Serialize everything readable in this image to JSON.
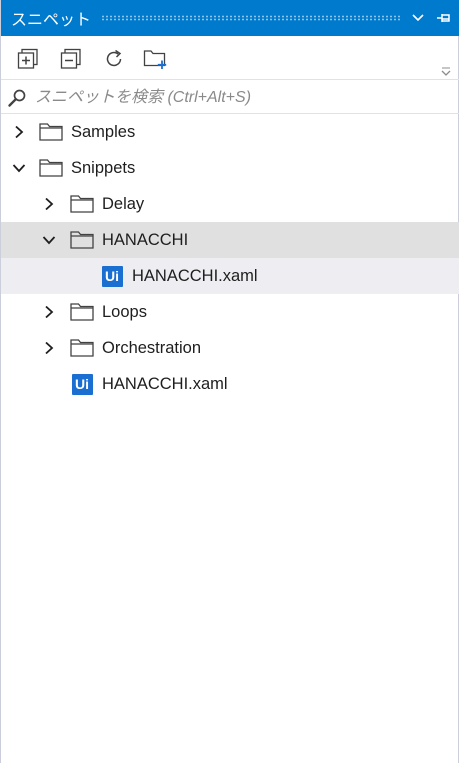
{
  "panel": {
    "title": "スニペット"
  },
  "toolbar": {
    "buttons": [
      {
        "name": "expand-all-button",
        "icon": "expand-all-icon"
      },
      {
        "name": "collapse-all-button",
        "icon": "collapse-all-icon"
      },
      {
        "name": "refresh-button",
        "icon": "refresh-icon"
      },
      {
        "name": "add-folder-button",
        "icon": "add-folder-icon"
      }
    ]
  },
  "search": {
    "placeholder": "スニペットを検索 (Ctrl+Alt+S)",
    "value": ""
  },
  "tree": {
    "samples": "Samples",
    "snippets": "Snippets",
    "delay": "Delay",
    "hanacchi_folder": "HANACCHI",
    "hanacchi_child_file": "HANACCHI.xaml",
    "loops": "Loops",
    "orchestration": "Orchestration",
    "hanacchi_file": "HANACCHI.xaml",
    "file_badge": "Ui"
  },
  "colors": {
    "titlebar": "#007acc",
    "selected_row": "#e0e0e0",
    "hover_row": "#eeeef2",
    "ui_badge": "#1a6fd1"
  }
}
